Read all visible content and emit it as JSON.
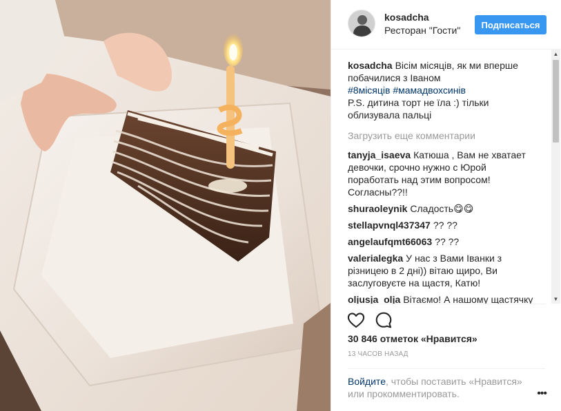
{
  "post": {
    "username": "kosadcha",
    "location": "Ресторан \"Гости\"",
    "follow_label": "Подписаться"
  },
  "caption": {
    "user": "kosadcha",
    "text": "Вісім місяців, як ми вперше побачилися з Іваном",
    "hashtags": "#8місяців #мамадвохсинів",
    "text2": "P.S. дитина торт не їла :) тільки облизувала пальці"
  },
  "load_more": "Загрузить еще комментарии",
  "comments": [
    {
      "user": "tanyja_isaeva",
      "text": "Катюша , Вам не хватает девочки, срочно нужно с Юрой поработать над этим вопросом! Согласны??!!"
    },
    {
      "user": "shuraoleynik",
      "text": "Сладость😋😋"
    },
    {
      "user": "stellapvnql437347",
      "text": "?? ??"
    },
    {
      "user": "angelaufqmt66063",
      "text": "?? ??"
    },
    {
      "user": "valerialegka",
      "text": "У нас з Вами Іванки з різницею в 2 дні)) вітаю щиро, Ви заслуговуєте на щастя, Катю!"
    },
    {
      "user": "oljusja_olja",
      "text": "Вітаємо! А нашому щастячку"
    }
  ],
  "likes": "30 846 отметок «Нравится»",
  "time": "13 ЧАСОВ НАЗАД",
  "login": {
    "link": "Войдите",
    "rest": ", чтобы поставить «Нравится» или прокомментировать."
  },
  "more": "•••",
  "icons": {
    "like": "heart-icon",
    "comment": "comment-bubble-icon",
    "more": "more-options-icon"
  },
  "colors": {
    "accent": "#3897f0",
    "link": "#003569",
    "muted": "#999999"
  }
}
